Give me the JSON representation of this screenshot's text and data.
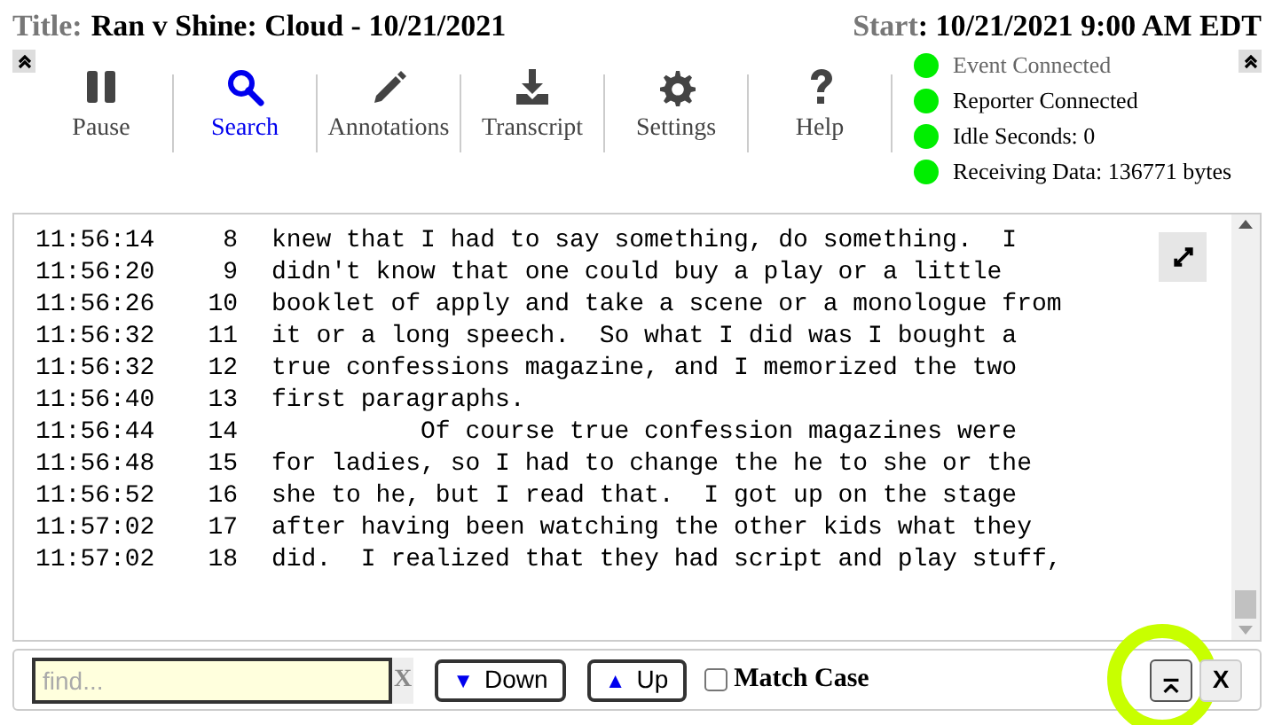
{
  "header": {
    "title_label": "Title:",
    "title": "Ran v Shine: Cloud - 10/21/2021",
    "start_label": "Start",
    "start": ": 10/21/2021 9:00 AM EDT"
  },
  "toolbar": [
    {
      "label": "Pause",
      "kind": "pause",
      "selected": false
    },
    {
      "label": "Search",
      "kind": "search",
      "selected": true
    },
    {
      "label": "Annotations",
      "kind": "pencil",
      "selected": false
    },
    {
      "label": "Transcript",
      "kind": "download",
      "selected": false
    },
    {
      "label": "Settings",
      "kind": "gear",
      "selected": false
    },
    {
      "label": "Help",
      "kind": "help",
      "selected": false
    }
  ],
  "status": [
    {
      "label": "Event Connected",
      "color": "#00ee00",
      "dim": true
    },
    {
      "label": "Reporter Connected",
      "color": "#00ee00",
      "dim": false
    },
    {
      "label": "Idle Seconds: 0",
      "color": "#00ee00",
      "dim": false
    },
    {
      "label": "Receiving Data: 136771 bytes",
      "color": "#00ee00",
      "dim": false
    }
  ],
  "transcript": [
    {
      "time": "11:56:14",
      "line": "8",
      "text": "knew that I had to say something, do something.  I"
    },
    {
      "time": "11:56:20",
      "line": "9",
      "text": "didn't know that one could buy a play or a little"
    },
    {
      "time": "11:56:26",
      "line": "10",
      "text": "booklet of apply and take a scene or a monologue from"
    },
    {
      "time": "11:56:32",
      "line": "11",
      "text": "it or a long speech.  So what I did was I bought a"
    },
    {
      "time": "11:56:32",
      "line": "12",
      "text": "true confessions magazine, and I memorized the two"
    },
    {
      "time": "11:56:40",
      "line": "13",
      "text": "first paragraphs."
    },
    {
      "time": "11:56:44",
      "line": "14",
      "text": "          Of course true confession magazines were"
    },
    {
      "time": "11:56:48",
      "line": "15",
      "text": "for ladies, so I had to change the he to she or the"
    },
    {
      "time": "11:56:52",
      "line": "16",
      "text": "she to he, but I read that.  I got up on the stage"
    },
    {
      "time": "11:57:02",
      "line": "17",
      "text": "after having been watching the other kids what they"
    },
    {
      "time": "11:57:02",
      "line": "18",
      "text": "did.  I realized that they had script and play stuff,"
    }
  ],
  "search": {
    "placeholder": "find...",
    "clear": "X",
    "down": "Down",
    "down_icon": "▼",
    "up": "Up",
    "up_icon": "▲",
    "match_case": "Match Case",
    "match_case_checked": false,
    "top_button": "⌅",
    "close_button": "X"
  }
}
